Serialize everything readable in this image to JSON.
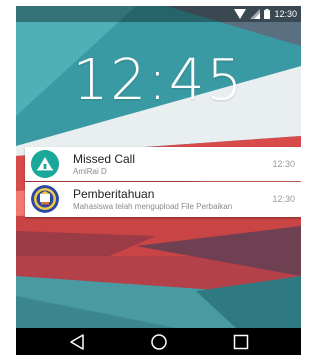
{
  "status_bar": {
    "time": "12:30",
    "icons": [
      "wifi-icon",
      "signal-icon",
      "battery-icon"
    ]
  },
  "lock_screen": {
    "clock": "12:45"
  },
  "notifications": [
    {
      "icon": "tent-app-icon",
      "icon_color": "#1aa89b",
      "title": "Missed Call",
      "subtitle": "AmiRai D",
      "time": "12:30"
    },
    {
      "icon": "university-seal-icon",
      "icon_color": "#2a4aa0",
      "title": "Pemberitahuan",
      "subtitle": "Mahasiswa telah mengupload File Perbaikan",
      "time": "12:30"
    }
  ],
  "nav_bar": {
    "buttons": [
      "back-icon",
      "home-icon",
      "recents-icon"
    ]
  },
  "colors": {
    "accent_teal": "#1aa89b",
    "wallpaper_red": "#e64a4a",
    "wallpaper_teal": "#2f8f95",
    "nav_bg": "#000000"
  }
}
